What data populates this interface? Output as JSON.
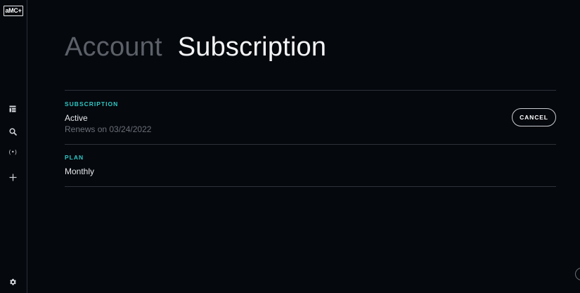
{
  "sidebar": {
    "logo_text": "aMC+",
    "icons": [
      {
        "name": "guide-icon"
      },
      {
        "name": "search-icon"
      },
      {
        "name": "live-icon",
        "glyph": "(•)"
      },
      {
        "name": "add-icon"
      },
      {
        "name": "settings-icon"
      }
    ]
  },
  "header": {
    "tabs": [
      {
        "label": "Account",
        "active": false
      },
      {
        "label": "Subscription",
        "active": true
      }
    ]
  },
  "subscription": {
    "label": "SUBSCRIPTION",
    "status": "Active",
    "renews": "Renews on 03/24/2022",
    "cancel_label": "CANCEL"
  },
  "plan": {
    "label": "PLAN",
    "value": "Monthly"
  },
  "colors": {
    "background": "#05080d",
    "accent": "#2fc7c4",
    "active_tab": "#f3f4f6",
    "inactive_tab": "#5c6068",
    "muted_text": "#6a6f77"
  }
}
